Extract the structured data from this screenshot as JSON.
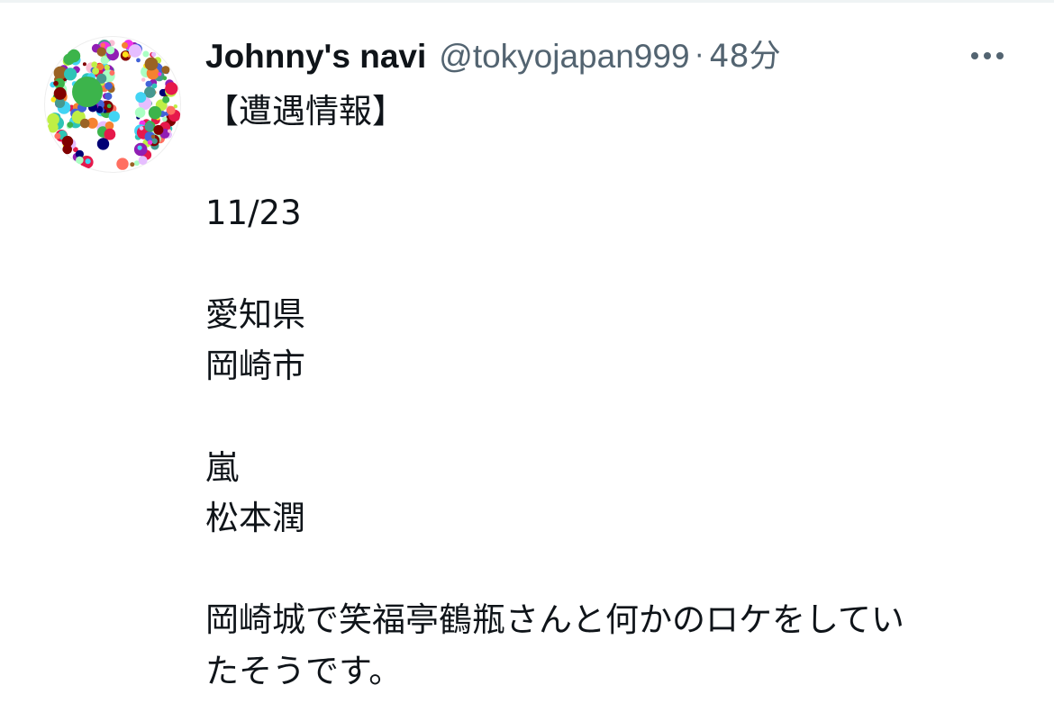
{
  "tweet": {
    "author": {
      "display_name": "Johnny's navi",
      "handle": "@tokyojapan999",
      "avatar_icon": "johnnys-j-dots-avatar"
    },
    "separator": "·",
    "timestamp": "48分",
    "more_icon": "more-options-icon",
    "text": "【遭遇情報】\n\n11/23\n\n愛知県\n岡崎市\n\n嵐\n松本潤\n\n岡崎城で笑福亭鶴瓶さんと何かのロケをしてい\nたそうです。"
  },
  "colors": {
    "text_primary": "#0f1419",
    "text_secondary": "#536471",
    "divider": "#eff3f4"
  }
}
